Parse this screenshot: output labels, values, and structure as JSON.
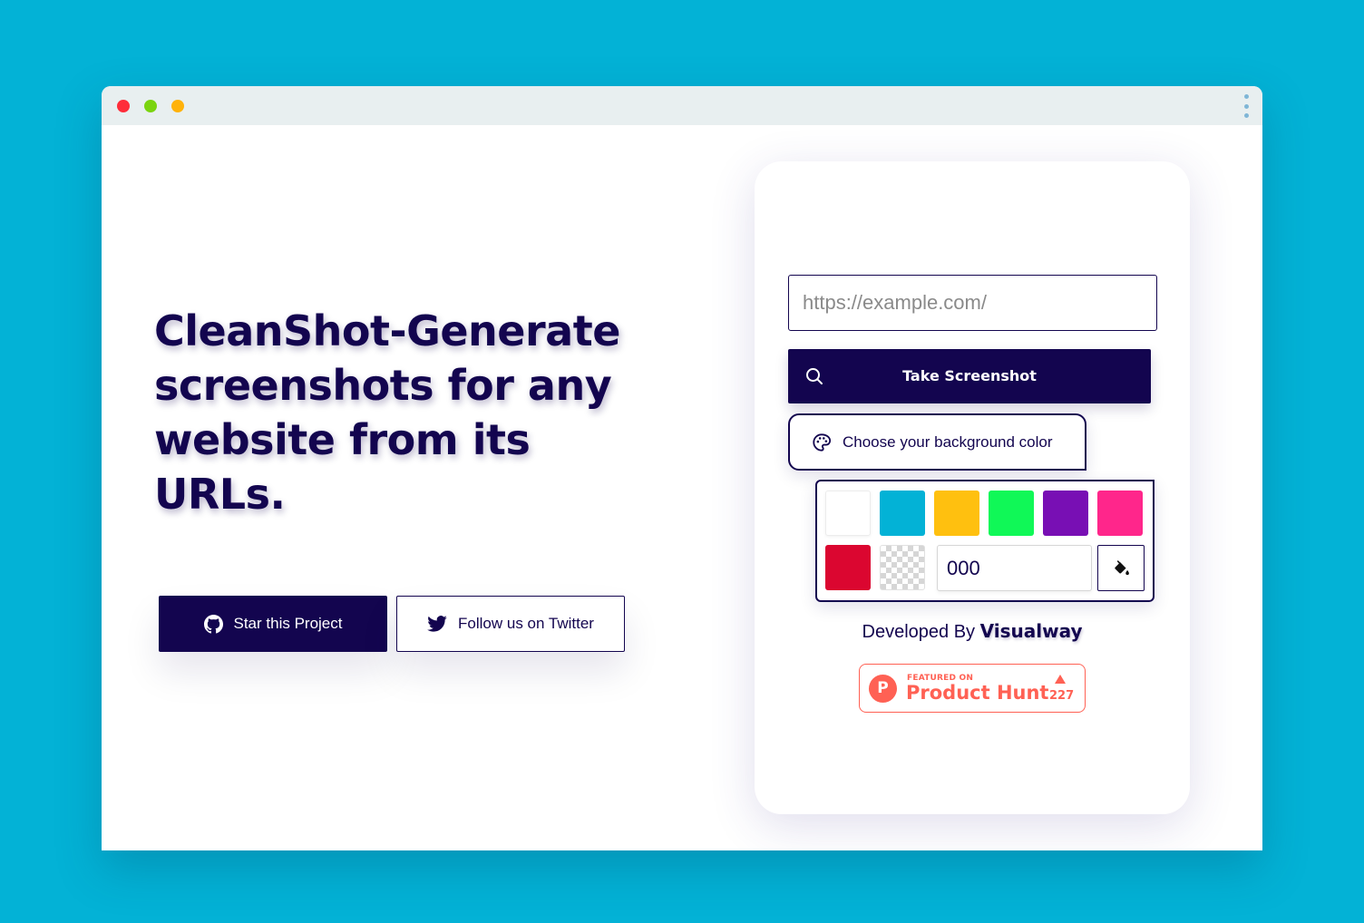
{
  "window": {
    "controls": [
      {
        "name": "close",
        "color": "#fe2d3a"
      },
      {
        "name": "maximize",
        "color": "#7ad40f"
      },
      {
        "name": "minimize",
        "color": "#ffb20a"
      }
    ],
    "menu_icon": "kebab-menu-icon"
  },
  "hero": {
    "headline": "CleanShot-Generate screenshots for any website from its URLs.",
    "buttons": {
      "star_label": "Star this Project",
      "star_icon": "github-icon",
      "twitter_label": "Follow us on Twitter",
      "twitter_icon": "twitter-icon"
    }
  },
  "form": {
    "url_placeholder": "https://example.com/",
    "url_value": "",
    "submit_label": "Take Screenshot",
    "submit_icon": "search-icon",
    "bg_toggle_label": "Choose your background color",
    "bg_toggle_icon": "palette-icon",
    "swatches": [
      {
        "name": "white",
        "color": "#ffffff"
      },
      {
        "name": "cyan",
        "color": "#03b2d6"
      },
      {
        "name": "amber",
        "color": "#ffc00f"
      },
      {
        "name": "green",
        "color": "#10f857"
      },
      {
        "name": "purple",
        "color": "#780fb4"
      },
      {
        "name": "pink",
        "color": "#ff268b"
      },
      {
        "name": "red",
        "color": "#db0630"
      },
      {
        "name": "transparent",
        "color": "transparent"
      }
    ],
    "hex_value": "000",
    "picker_icon": "paint-bucket-icon"
  },
  "footer": {
    "developed_by": "Developed By",
    "brand": "Visualway"
  },
  "product_hunt": {
    "featured": "FEATURED ON",
    "name": "Product Hunt",
    "count": "227",
    "logo_letter": "P"
  },
  "colors": {
    "background": "#03b2d6",
    "primary": "#13054f",
    "product_hunt": "#ff6154"
  }
}
